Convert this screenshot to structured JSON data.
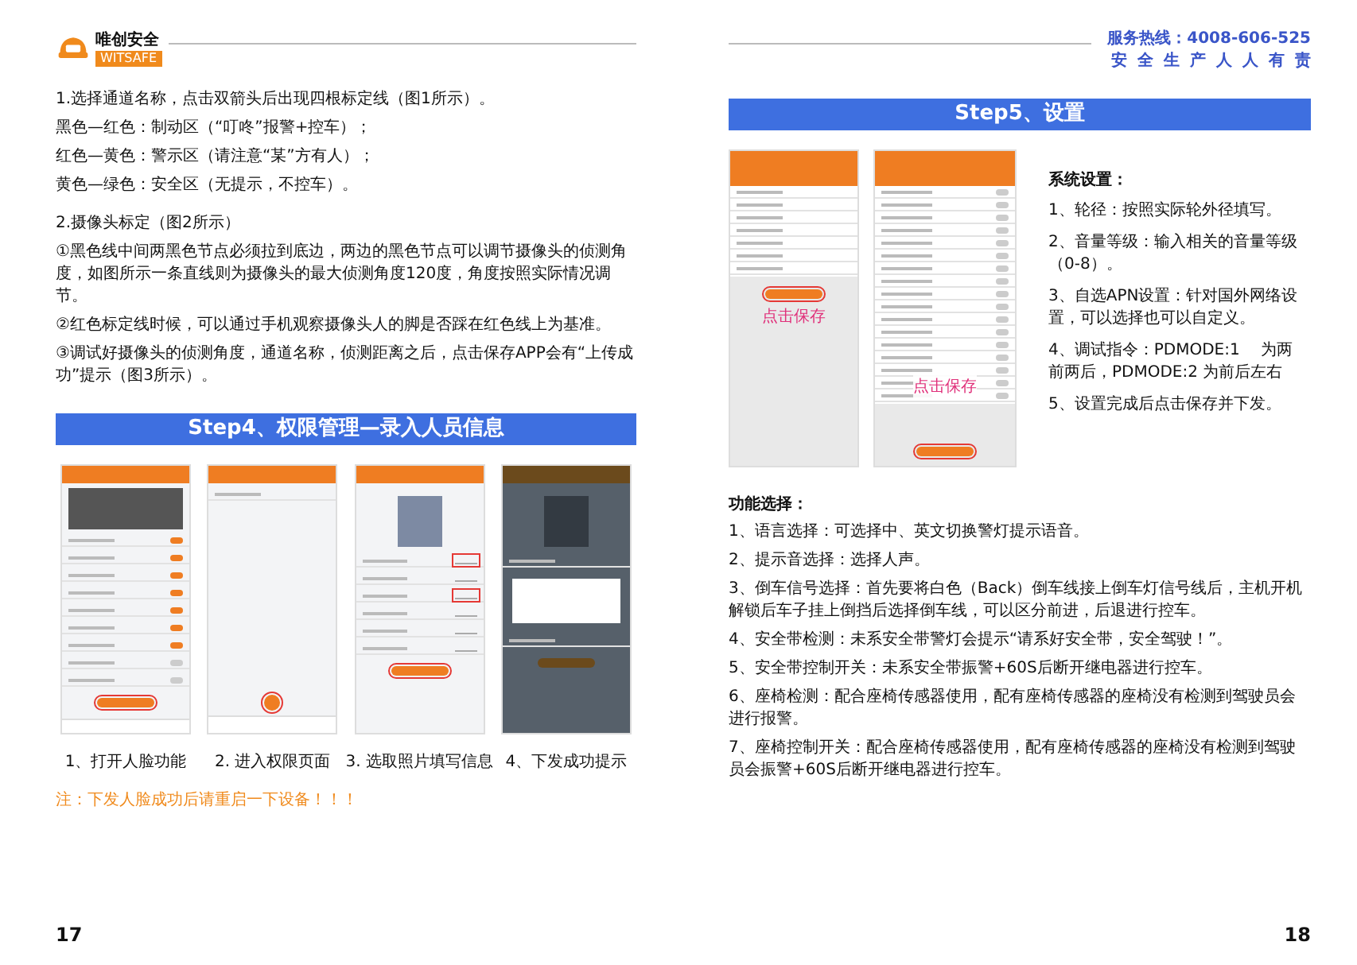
{
  "header": {
    "brand": "唯创安全",
    "brand_badge": "WITSAFE",
    "hotline": "服务热线：4008-606-525",
    "slogan": "安 全 生 产 人 人 有 责"
  },
  "left_page": {
    "calibration_lines": [
      "1.选择通道名称，点击双箭头后出现四根标定线（图1所示）。",
      "黑色—红色：制动区（“叮咚”报警+控车）；",
      "红色—黄色：警示区（请注意“某”方有人）；",
      "黄色—绿色：安全区（无提示，不控车）。"
    ],
    "camera_calibration": [
      "2.摄像头标定（图2所示）",
      "①黑色线中间两黑色节点必须拉到底边，两边的黑色节点可以调节摄像头的侦测角度，如图所示一条直线则为摄像头的最大侦测角度120度，角度按照实际情况调节。",
      "②红色标定线时候，可以通过手机观察摄像头人的脚是否踩在红色线上为基准。",
      "③调试好摄像头的侦测角度，通道名称，侦测距离之后，点击保存APP会有“上传成功”提示（图3所示）。"
    ],
    "step4": {
      "title": "Step4、权限管理—录入人员信息",
      "screens": [
        {
          "kind": "face-toggle",
          "caption": "1、打开人脸功能",
          "toggles": [
            {
              "on": true
            },
            {
              "on": true
            },
            {
              "on": true
            },
            {
              "on": true
            },
            {
              "on": true
            },
            {
              "on": true
            },
            {
              "on": true
            },
            {
              "on": false
            },
            {
              "on": false
            }
          ]
        },
        {
          "kind": "permission",
          "caption": "2. 进入权限页面"
        },
        {
          "kind": "photo-form",
          "caption": "3. 选取照片填写信息"
        },
        {
          "kind": "success-dialog",
          "caption": "4、下发成功提示"
        }
      ],
      "note": "注：下发人脸成功后请重启一下设备！！！"
    },
    "page_number": "17"
  },
  "right_page": {
    "step5": {
      "title": "Step5、设置",
      "screens": [
        {
          "kind": "wheel-settings",
          "annotation": "点击保存"
        },
        {
          "kind": "function-settings",
          "annotation": "点击保存",
          "toggles": [
            {
              "on": false
            },
            {
              "on": false
            },
            {
              "on": false
            },
            {
              "on": false
            },
            {
              "on": false
            },
            {
              "on": false
            },
            {
              "on": false
            },
            {
              "on": false
            },
            {
              "on": false
            },
            {
              "on": false
            },
            {
              "on": false
            },
            {
              "on": false
            },
            {
              "on": false
            },
            {
              "on": false
            },
            {
              "on": false
            },
            {
              "on": false
            },
            {
              "on": false
            }
          ]
        }
      ],
      "settings": {
        "heading": "系统设置：",
        "items": [
          "1、轮径：按照实际轮外径填写。",
          "2、音量等级：输入相关的音量等级（0-8）。",
          "3、自选APN设置：针对国外网络设置，可以选择也可以自定义。",
          "4、调试指令：PDMODE:1　 为两前两后，PDMODE:2 为前后左右",
          "5、设置完成后点击保存并下发。"
        ]
      }
    },
    "features": {
      "heading": "功能选择：",
      "items": [
        "1、语言选择：可选择中、英文切换警灯提示语音。",
        "2、提示音选择：选择人声。",
        "3、倒车信号选择：首先要将白色（Back）倒车线接上倒车灯信号线后，主机开机解锁后车子挂上倒挡后选择倒车线，可以区分前进，后退进行控车。",
        "4、安全带检测：未系安全带警灯会提示“请系好安全带，安全驾驶！”。",
        "5、安全带控制开关：未系安全带振警+60S后断开继电器进行控车。",
        "6、座椅检测：配合座椅传感器使用，配有座椅传感器的座椅没有检测到驾驶员会进行报警。",
        "7、座椅控制开关：配合座椅传感器使用，配有座椅传感器的座椅没有检测到驾驶员会振警+60S后断开继电器进行控车。"
      ]
    },
    "page_number": "18"
  }
}
